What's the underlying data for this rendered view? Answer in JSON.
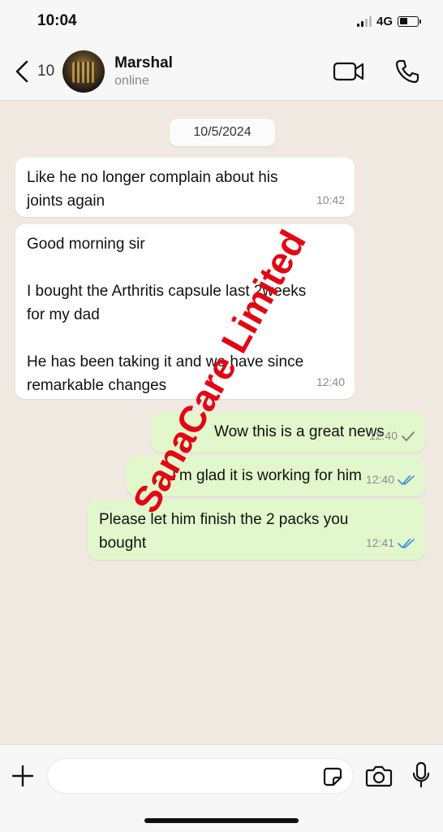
{
  "status_bar": {
    "time": "10:04",
    "network": "4G"
  },
  "header": {
    "back_count": "10",
    "contact_name": "Marshal",
    "contact_status": "online"
  },
  "chat": {
    "date_label": "10/5/2024",
    "messages": [
      {
        "direction": "incoming",
        "text": "Like he no longer complain about his\njoints again",
        "time": "10:42"
      },
      {
        "direction": "incoming",
        "text": "Good morning sir\n\nI bought the Arthritis capsule last 2weeks\nfor my dad\n\nHe has been taking it and we have since\nremarkable changes",
        "time": "12:40"
      },
      {
        "direction": "outgoing",
        "text": "Wow this is a great news",
        "time": "12:40",
        "status": "sent"
      },
      {
        "direction": "outgoing",
        "text": "I'm glad it is working for him",
        "time": "12:40",
        "status": "read"
      },
      {
        "direction": "outgoing",
        "text": "Please let him finish the 2 packs you\nbought",
        "time": "12:41",
        "status": "read"
      }
    ]
  },
  "watermark": "SanaCare Limited",
  "icons": {
    "back": "chevron-left-icon",
    "video": "video-camera-icon",
    "call": "phone-icon",
    "attach": "plus-icon",
    "sticker": "sticker-icon",
    "camera": "camera-icon",
    "mic": "microphone-icon"
  },
  "colors": {
    "incoming_bubble": "#ffffff",
    "outgoing_bubble": "#e2f7cb",
    "read_ticks": "#4a90d9",
    "watermark": "#e30613",
    "chat_background": "#efe9e1"
  }
}
